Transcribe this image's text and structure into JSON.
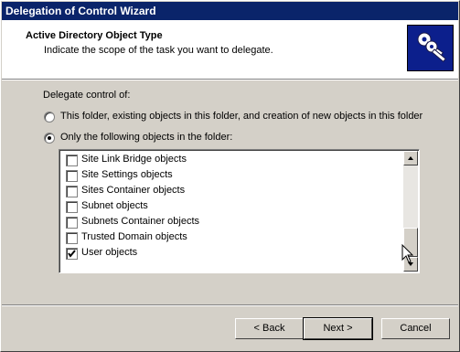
{
  "window": {
    "title": "Delegation of Control Wizard"
  },
  "header": {
    "title": "Active Directory Object Type",
    "subtitle": "Indicate the scope of the task you want to delegate.",
    "icon": "keys-icon"
  },
  "delegate": {
    "label": "Delegate control of:",
    "options": [
      {
        "label": "This folder, existing objects in this folder, and creation of new objects in this folder",
        "selected": false
      },
      {
        "label": "Only the following objects in the folder:",
        "selected": true
      }
    ]
  },
  "objects": [
    {
      "label": "Site Link Bridge objects",
      "checked": false
    },
    {
      "label": "Site Settings objects",
      "checked": false
    },
    {
      "label": "Sites Container objects",
      "checked": false
    },
    {
      "label": "Subnet objects",
      "checked": false
    },
    {
      "label": "Subnets Container objects",
      "checked": false
    },
    {
      "label": "Trusted Domain objects",
      "checked": false
    },
    {
      "label": "User objects",
      "checked": true
    }
  ],
  "buttons": {
    "back": "< Back",
    "next": "Next >",
    "cancel": "Cancel"
  },
  "colors": {
    "titlebar": "#0a246a",
    "face": "#d4d0c8",
    "icon_bg": "#0c1f8c"
  }
}
